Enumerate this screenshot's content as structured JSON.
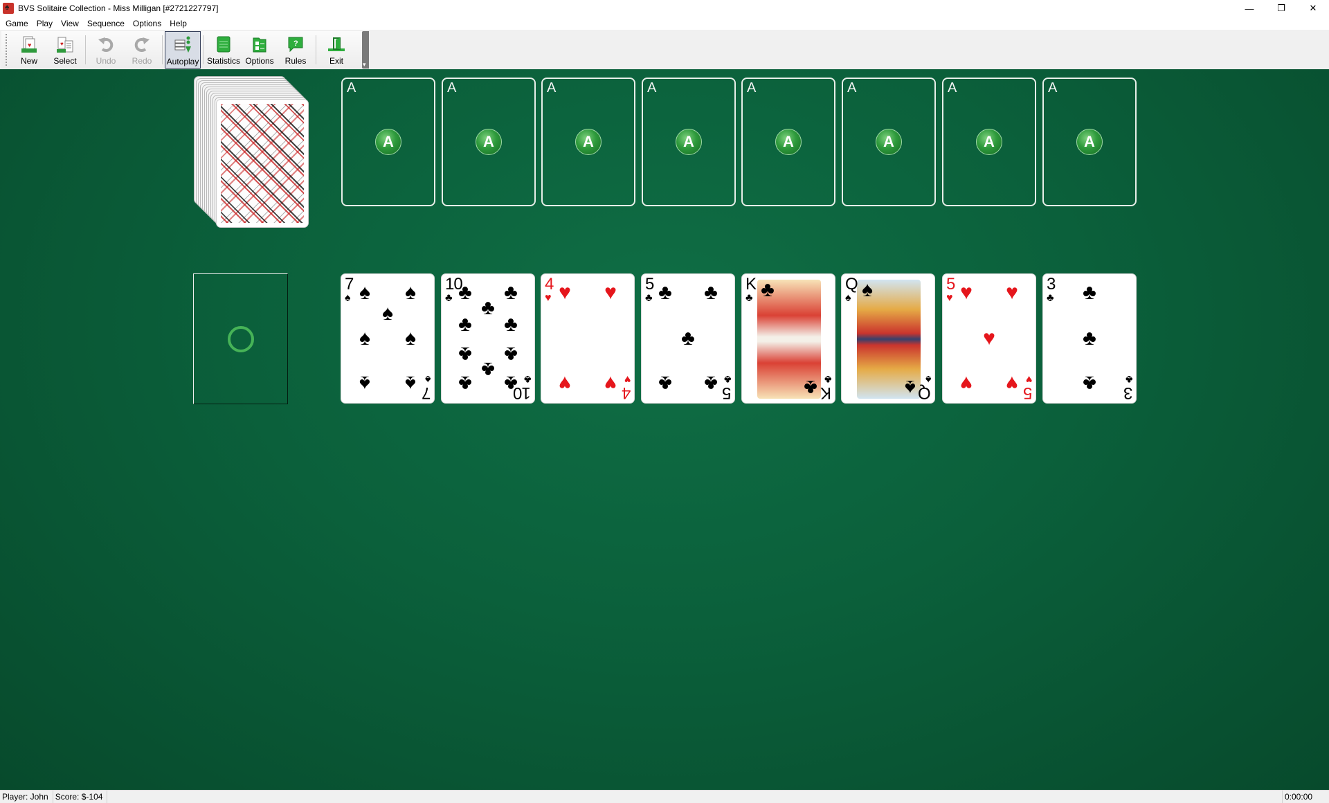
{
  "window": {
    "title": "BVS Solitaire Collection  -  Miss Milligan [#2721227797]",
    "controls": {
      "minimize": "—",
      "restore": "❐",
      "close": "✕"
    }
  },
  "menu": [
    "Game",
    "Play",
    "View",
    "Sequence",
    "Options",
    "Help"
  ],
  "toolbar": {
    "buttons": [
      {
        "label": "New",
        "icon": "new-game-icon",
        "state": "enabled"
      },
      {
        "label": "Select",
        "icon": "select-game-icon",
        "state": "enabled"
      },
      {
        "label": "Undo",
        "icon": "undo-icon",
        "state": "disabled"
      },
      {
        "label": "Redo",
        "icon": "redo-icon",
        "state": "disabled"
      },
      {
        "label": "Autoplay",
        "icon": "autoplay-icon",
        "state": "pressed"
      },
      {
        "label": "Statistics",
        "icon": "statistics-icon",
        "state": "enabled"
      },
      {
        "label": "Options",
        "icon": "options-icon",
        "state": "enabled"
      },
      {
        "label": "Rules",
        "icon": "rules-icon",
        "state": "enabled"
      },
      {
        "label": "Exit",
        "icon": "exit-icon",
        "state": "enabled"
      }
    ]
  },
  "game": {
    "stock": {
      "type": "face-down deck"
    },
    "foundations": [
      {
        "label": "A",
        "badge": "A"
      },
      {
        "label": "A",
        "badge": "A"
      },
      {
        "label": "A",
        "badge": "A"
      },
      {
        "label": "A",
        "badge": "A"
      },
      {
        "label": "A",
        "badge": "A"
      },
      {
        "label": "A",
        "badge": "A"
      },
      {
        "label": "A",
        "badge": "A"
      },
      {
        "label": "A",
        "badge": "A"
      }
    ],
    "waste": {
      "state": "empty"
    },
    "tableau": [
      {
        "rank": "7",
        "suit": "♠",
        "color": "black"
      },
      {
        "rank": "10",
        "suit": "♣",
        "color": "black"
      },
      {
        "rank": "4",
        "suit": "♥",
        "color": "red"
      },
      {
        "rank": "5",
        "suit": "♣",
        "color": "black"
      },
      {
        "rank": "K",
        "suit": "♣",
        "color": "black"
      },
      {
        "rank": "Q",
        "suit": "♠",
        "color": "black"
      },
      {
        "rank": "5",
        "suit": "♥",
        "color": "red"
      },
      {
        "rank": "3",
        "suit": "♣",
        "color": "black"
      }
    ]
  },
  "status": {
    "player": "Player: John",
    "score": "Score: $-104",
    "time": "0:00:00"
  },
  "colors": {
    "felt": "#0b603b",
    "red_suit": "#e5161c",
    "badge_green": "#2e9a3c"
  }
}
